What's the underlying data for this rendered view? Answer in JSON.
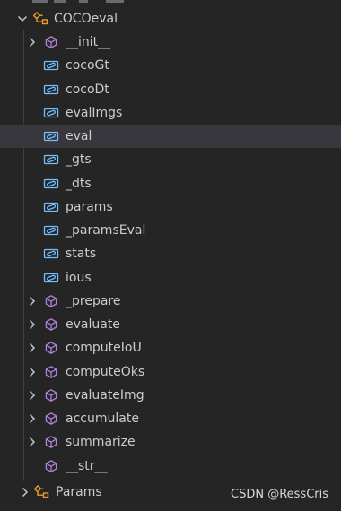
{
  "tree": {
    "root": {
      "label": "COCOeval",
      "icon": "class-icon",
      "expanded": true
    },
    "children": [
      {
        "label": "__init__",
        "kind": "method",
        "expandable": true
      },
      {
        "label": "cocoGt",
        "kind": "field",
        "expandable": false
      },
      {
        "label": "cocoDt",
        "kind": "field",
        "expandable": false
      },
      {
        "label": "evalImgs",
        "kind": "field",
        "expandable": false
      },
      {
        "label": "eval",
        "kind": "field",
        "expandable": false,
        "selected": true
      },
      {
        "label": "_gts",
        "kind": "field",
        "expandable": false
      },
      {
        "label": "_dts",
        "kind": "field",
        "expandable": false
      },
      {
        "label": "params",
        "kind": "field",
        "expandable": false
      },
      {
        "label": "_paramsEval",
        "kind": "field",
        "expandable": false
      },
      {
        "label": "stats",
        "kind": "field",
        "expandable": false
      },
      {
        "label": "ious",
        "kind": "field",
        "expandable": false
      },
      {
        "label": "_prepare",
        "kind": "method",
        "expandable": true
      },
      {
        "label": "evaluate",
        "kind": "method",
        "expandable": true
      },
      {
        "label": "computeIoU",
        "kind": "method",
        "expandable": true
      },
      {
        "label": "computeOks",
        "kind": "method",
        "expandable": true
      },
      {
        "label": "evaluateImg",
        "kind": "method",
        "expandable": true
      },
      {
        "label": "accumulate",
        "kind": "method",
        "expandable": true
      },
      {
        "label": "summarize",
        "kind": "method",
        "expandable": true
      },
      {
        "label": "__str__",
        "kind": "method",
        "expandable": false
      }
    ],
    "sibling": {
      "label": "Params",
      "icon": "class-icon",
      "expanded": false
    }
  },
  "watermark": "CSDN @RessCris",
  "colors": {
    "background": "#252526",
    "selected_row": "#37373d",
    "method_icon": "#b180d7",
    "field_icon": "#75beff",
    "class_icon": "#ee9d28",
    "text": "#cccccc"
  }
}
